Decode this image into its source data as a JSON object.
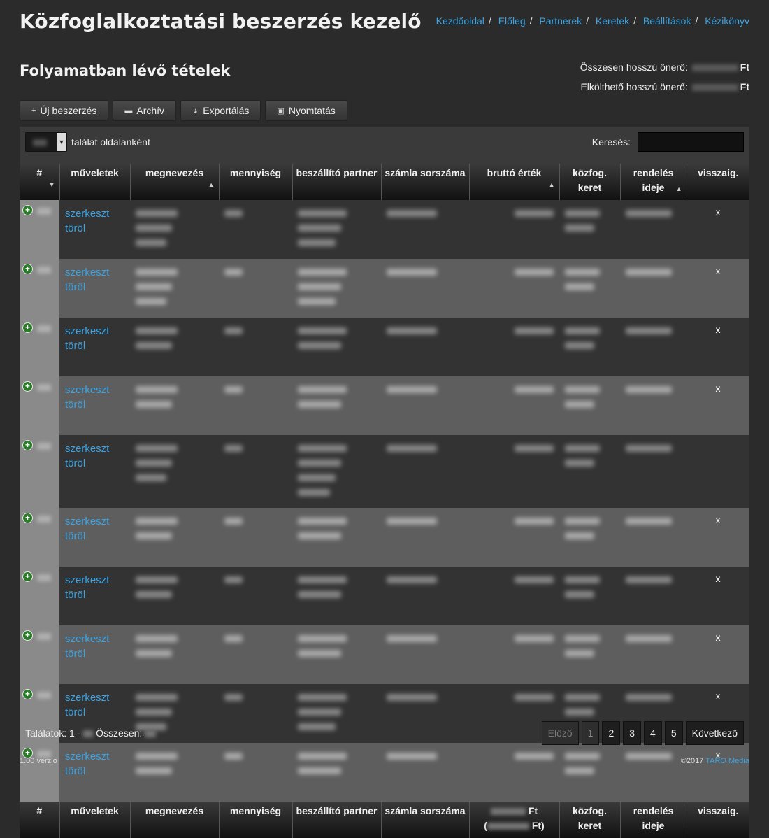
{
  "header": {
    "app_title": "Közfoglalkoztatási beszerzés kezelő",
    "nav": [
      "Kezdőoldal",
      "Előleg",
      "Partnerek",
      "Keretek",
      "Beállítások",
      "Kézikönyv"
    ]
  },
  "page_title": "Folyamatban lévő tételek",
  "summary": {
    "total_label": "Összesen hosszú önerő:",
    "available_label": "Elkölthető hosszú önerő:",
    "currency": "Ft"
  },
  "toolbar": {
    "new": "Új beszerzés",
    "archive": "Archív",
    "export": "Exportálás",
    "print": "Nyomtatás"
  },
  "table_controls": {
    "per_page_suffix": "találat oldalanként",
    "search_label": "Keresés:"
  },
  "columns": [
    "#",
    "műveletek",
    "megnevezés",
    "mennyiség",
    "beszállító partner",
    "számla sorszáma",
    "bruttó érték",
    "közfog. keret",
    "rendelés ideje",
    "visszaig."
  ],
  "footer_columns": {
    "gross": "Ft",
    "gross_total": "Ft)"
  },
  "actions": {
    "edit": "szerkeszt",
    "delete": "töröl"
  },
  "rows": [
    {
      "lines": 3,
      "ret": "x"
    },
    {
      "lines": 3,
      "ret": "x"
    },
    {
      "lines": 2,
      "ret": "x"
    },
    {
      "lines": 2,
      "ret": "x"
    },
    {
      "lines": 4,
      "ret": ""
    },
    {
      "lines": 2,
      "ret": "x"
    },
    {
      "lines": 2,
      "ret": "x"
    },
    {
      "lines": 2,
      "ret": "x"
    },
    {
      "lines": 3,
      "ret": "x"
    },
    {
      "lines": 2,
      "ret": "x"
    }
  ],
  "info": {
    "prefix": "Találatok: 1 -",
    "total": "Összesen:"
  },
  "pager": {
    "prev": "Előző",
    "pages": [
      "1",
      "2",
      "3",
      "4",
      "5"
    ],
    "next": "Következő"
  },
  "footer": {
    "version": "1.00 verzió",
    "copyright": "©2017",
    "company": "TARO Media"
  }
}
